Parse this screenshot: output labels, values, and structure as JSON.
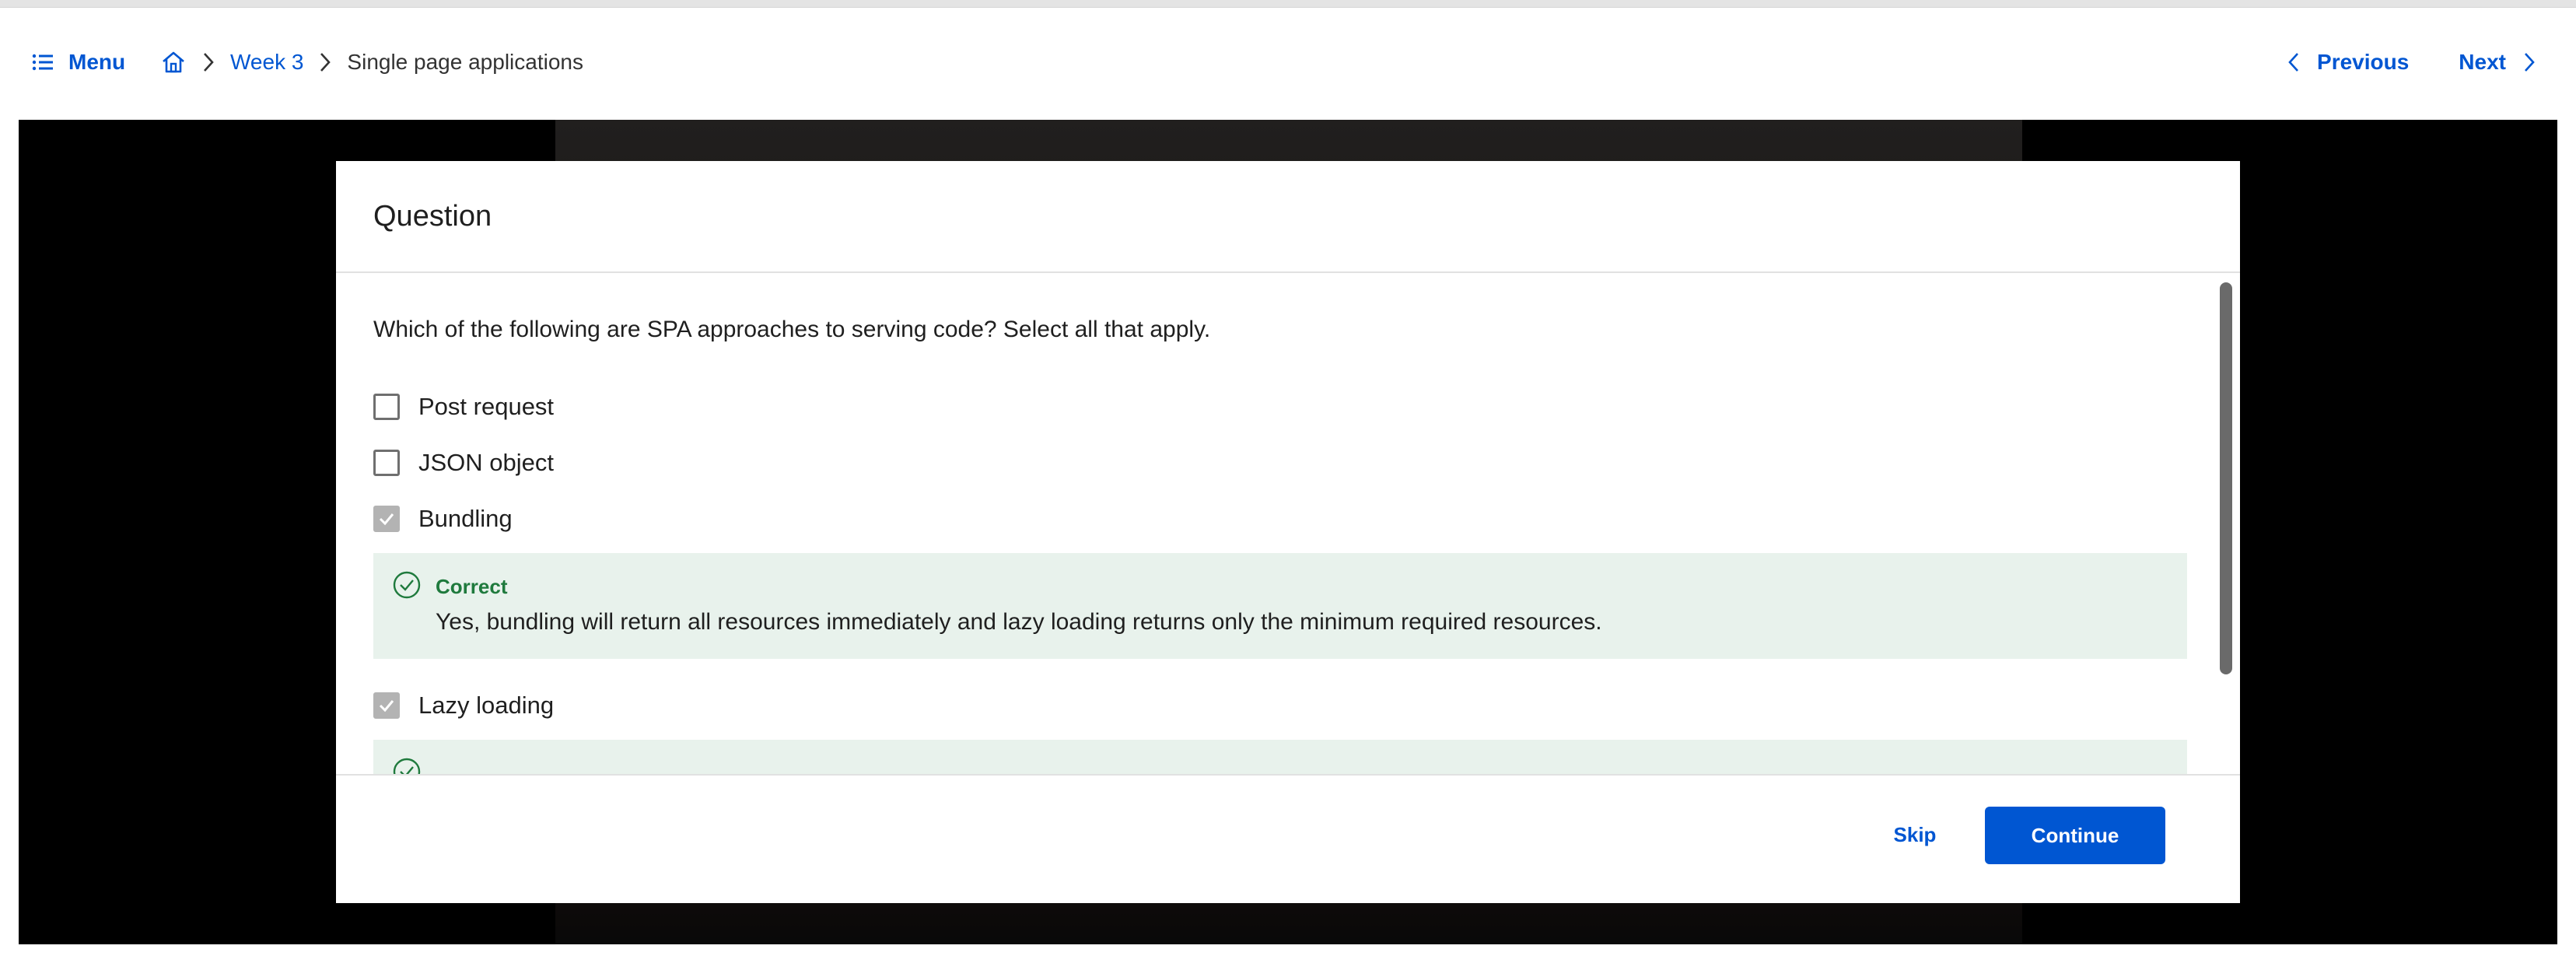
{
  "topbar": {
    "menu_label": "Menu",
    "breadcrumb": {
      "home_icon": "home-icon",
      "week_label": "Week 3",
      "current_label": "Single page applications"
    },
    "previous_label": "Previous",
    "next_label": "Next"
  },
  "modal": {
    "title": "Question",
    "prompt": "Which of the following are SPA approaches to serving code? Select all that apply.",
    "options": [
      {
        "label": "Post request",
        "checked": false
      },
      {
        "label": "JSON object",
        "checked": false
      },
      {
        "label": "Bundling",
        "checked": true
      },
      {
        "label": "Lazy loading",
        "checked": true
      }
    ],
    "feedback": [
      {
        "status": "Correct",
        "text": "Yes, bundling will return all resources immediately and lazy loading returns only the minimum required resources.",
        "icon": "check-circle-icon"
      }
    ],
    "footer": {
      "skip_label": "Skip",
      "continue_label": "Continue"
    }
  },
  "colors": {
    "accent": "#0056d2",
    "success": "#1f7a3d",
    "feedback_bg": "#e8f2ec"
  }
}
